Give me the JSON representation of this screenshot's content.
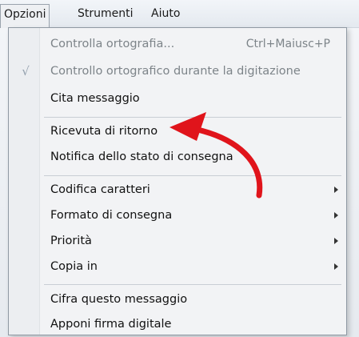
{
  "menubar": {
    "items": [
      {
        "label": "Opzioni"
      },
      {
        "label": "Strumenti"
      },
      {
        "label": "Aiuto"
      }
    ]
  },
  "menu": {
    "items": [
      {
        "label": "Controlla ortografia...",
        "shortcut": "Ctrl+Maiusc+P",
        "enabled": false
      },
      {
        "label": "Controllo ortografico durante la digitazione",
        "enabled": false,
        "checked": true,
        "check_glyph": "√"
      },
      {
        "label": "Cita messaggio",
        "enabled": true
      },
      {
        "label": "Ricevuta di ritorno",
        "enabled": true
      },
      {
        "label": "Notifica dello stato di consegna",
        "enabled": true
      },
      {
        "label": "Codifica caratteri",
        "enabled": true,
        "submenu": true
      },
      {
        "label": "Formato di consegna",
        "enabled": true,
        "submenu": true
      },
      {
        "label": "Priorità",
        "enabled": true,
        "submenu": true
      },
      {
        "label": "Copia in",
        "enabled": true,
        "submenu": true
      },
      {
        "label": "Cifra questo messaggio",
        "enabled": true
      },
      {
        "label": "Apponi firma digitale",
        "enabled": true
      }
    ]
  },
  "annotation": {
    "icon": "red-curved-arrow-icon",
    "color": "#e0141b",
    "points_to": "Ricevuta di ritorno"
  }
}
